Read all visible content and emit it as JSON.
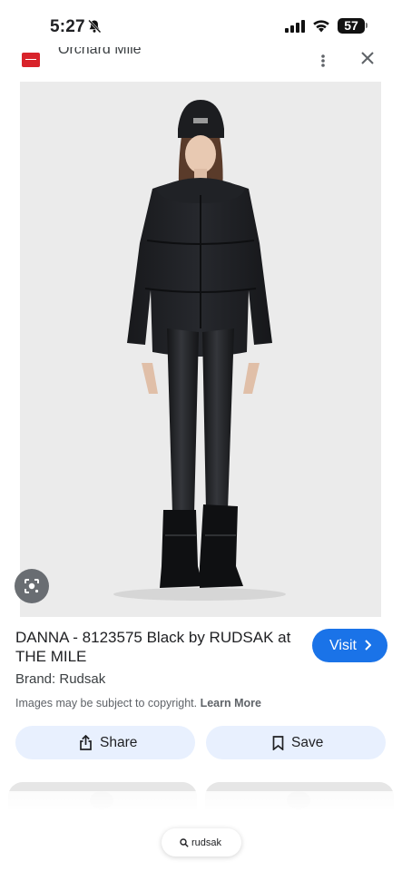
{
  "status_bar": {
    "time": "5:27",
    "battery": "57"
  },
  "source": {
    "name": "Orchard Mile"
  },
  "product": {
    "title": "DANNA - 8123575 Black by RUDSAK at THE MILE",
    "brand": "Brand: Rudsak",
    "copyright_text": "Images may be subject to copyright.",
    "learn_more": "Learn More"
  },
  "buttons": {
    "visit": "Visit",
    "share": "Share",
    "save": "Save"
  },
  "search_chip": {
    "query": "rudsak"
  },
  "colors": {
    "accent": "#1a73e8",
    "pill_bg": "#e8f0fe",
    "source_logo": "#d8232a"
  },
  "icons": [
    "bell-slash-icon",
    "signal-icon",
    "wifi-icon",
    "more-vert-icon",
    "close-icon",
    "lens-icon",
    "chevron-right-icon",
    "share-icon",
    "bookmark-icon",
    "search-icon"
  ]
}
